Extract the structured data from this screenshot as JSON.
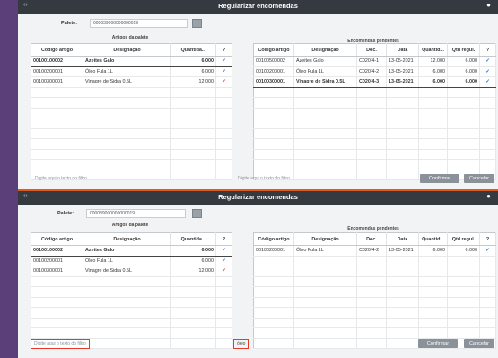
{
  "window1": {
    "title": "Regularizar encomendas",
    "pallet_label": "Palete:",
    "pallet_value": "000039000000000019",
    "left_caption": "Artigos da palete",
    "right_caption": "Encomendas pendentes",
    "left_headers": [
      "Código artigo",
      "Designação",
      "Quantida...",
      "?"
    ],
    "left_rows": [
      [
        "00100100002",
        "Azeites Galo",
        "6.000",
        "ok"
      ],
      [
        "00100200001",
        "Óleo Fula 1L",
        "6.000",
        "ok"
      ],
      [
        "00100300001",
        "Vinagre de Sidra 0.5L",
        "12.000",
        "bad"
      ]
    ],
    "right_headers": [
      "Código artigo",
      "Designação",
      "Doc.",
      "Data",
      "Quantid...",
      "Qtd regul.",
      "?"
    ],
    "right_rows": [
      [
        "00100500002",
        "Azeites Galo",
        "C020/4-1",
        "13-05-2021",
        "12.000",
        "6.000",
        "ok"
      ],
      [
        "00100200001",
        "Óleo Fula 1L",
        "C020/4-2",
        "13-05-2021",
        "6.000",
        "6.000",
        "ok"
      ],
      [
        "00100300001",
        "Vinagre de Sidra 0.5L",
        "C020/4-3",
        "13-05-2021",
        "6.000",
        "6.000",
        "ok"
      ]
    ],
    "left_filter_placeholder": "Digite aqui o texto do filtro",
    "right_filter_placeholder": "Digite aqui o texto do filtro",
    "confirm_label": "Confirmar",
    "cancel_label": "Cancelar"
  },
  "window2": {
    "title": "Regularizar encomendas",
    "pallet_label": "Palete:",
    "pallet_value": "000039000000000019",
    "left_caption": "Artigos da palete",
    "right_caption": "Encomendas pendentes",
    "left_headers": [
      "Código artigo",
      "Designação",
      "Quantida...",
      "?"
    ],
    "left_rows": [
      [
        "00100100002",
        "Azeites Galo",
        "6.000",
        "ok"
      ],
      [
        "00100200001",
        "Óleo Fula 1L",
        "6.000",
        "ok"
      ],
      [
        "00100300001",
        "Vinagre de Sidra 0.5L",
        "12.000",
        "bad"
      ]
    ],
    "right_headers": [
      "Código artigo",
      "Designação",
      "Doc.",
      "Data",
      "Quantid...",
      "Qtd regul.",
      "?"
    ],
    "right_rows": [
      [
        "00100200001",
        "Óleo Fula 1L",
        "C020/4-2",
        "13-05-2021",
        "6.000",
        "6.000",
        "ok"
      ]
    ],
    "left_filter_placeholder": "Digite aqui o texto do filtro",
    "right_filter_value": "óleo",
    "confirm_label": "Confirmar",
    "cancel_label": "Cancelar"
  },
  "colors": {
    "titlebar": "#343a40",
    "highlight": "#e53b2f",
    "check_ok": "#2a6fc9",
    "check_bad": "#d43030"
  },
  "icons": {
    "ok": "check-icon",
    "bad": "check-warning-icon"
  }
}
